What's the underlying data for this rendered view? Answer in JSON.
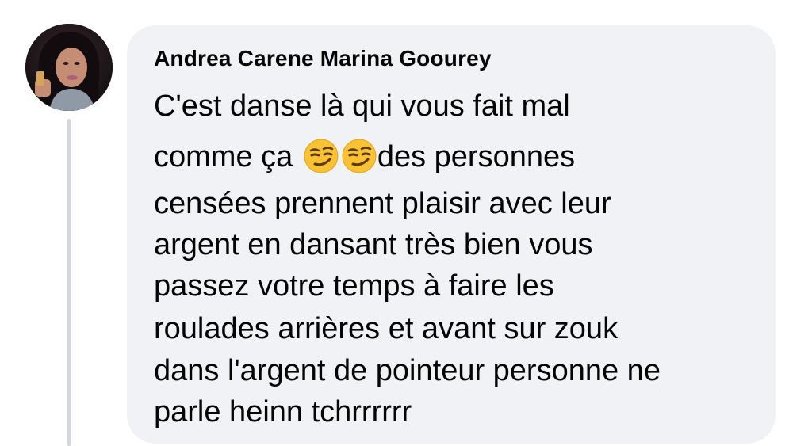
{
  "comment": {
    "author_name": "Andrea Carene Marina Goourey",
    "lines": [
      "C'est danse là qui vous fait mal",
      "comme ça",
      "des personnes",
      "censées prennent plaisir avec leur",
      "argent en dansant très bien vous",
      "passez votre temps à faire les",
      "roulades arrières et avant sur zouk",
      "dans l'argent de pointeur personne ne",
      "parle heinn tchrrrrrr"
    ],
    "emojis": [
      "smirking-face-emoji",
      "smirking-face-emoji"
    ]
  },
  "colors": {
    "bubble_background": "#f0f2f5",
    "text": "#050505",
    "thread_line": "#d4d7dc"
  }
}
